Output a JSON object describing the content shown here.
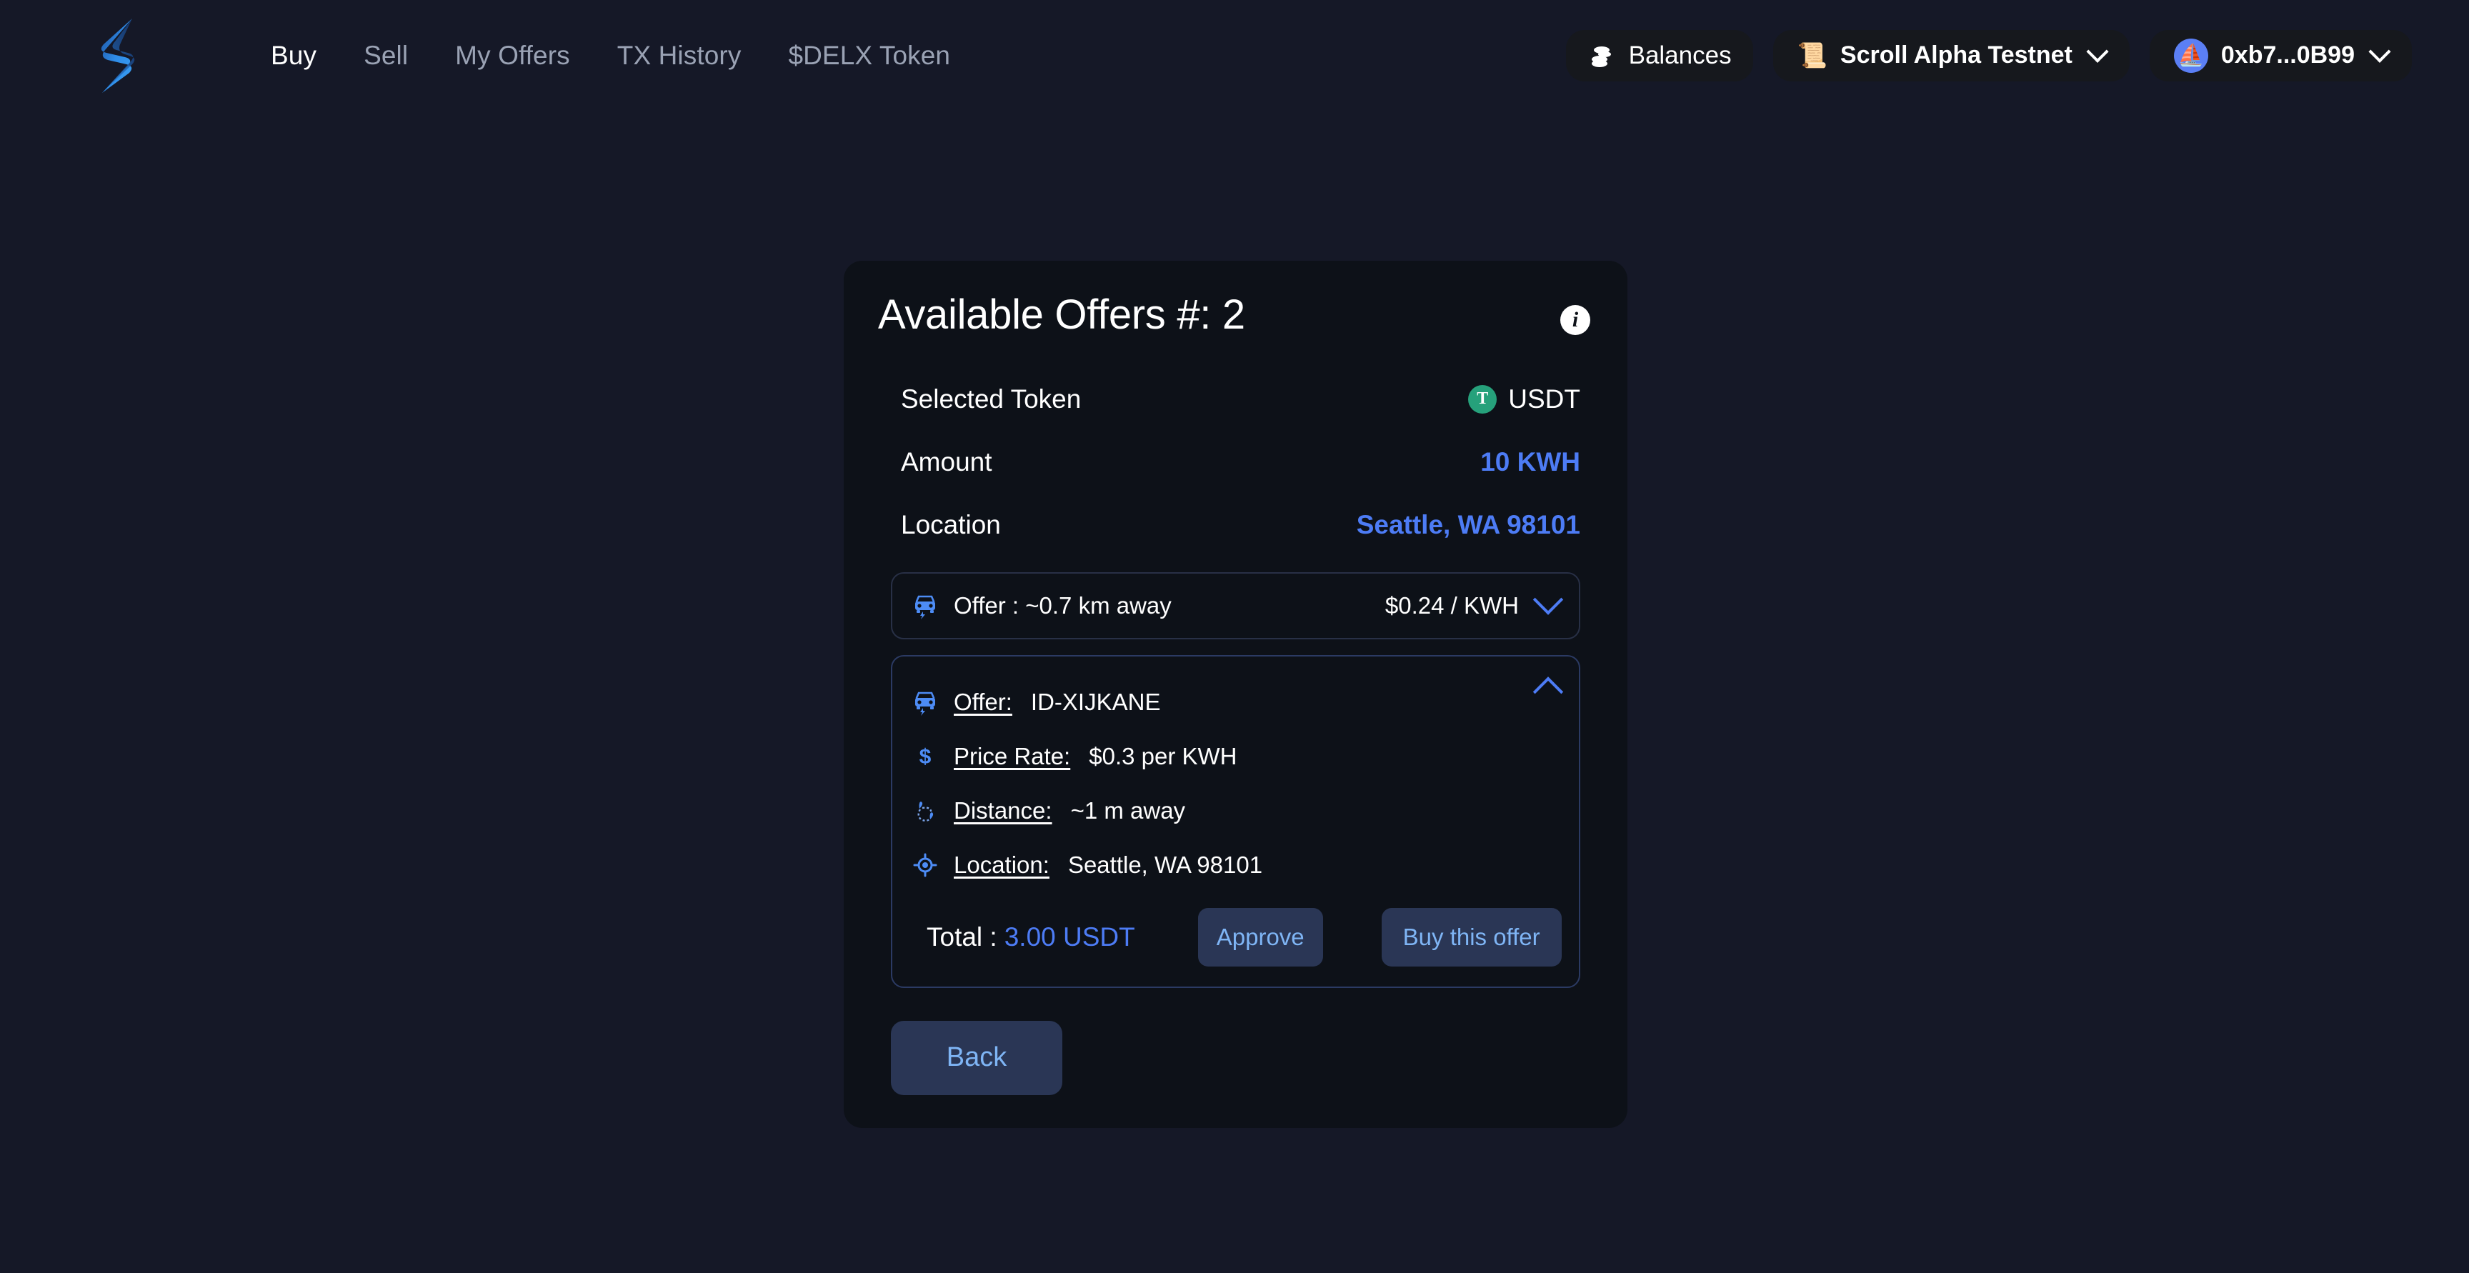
{
  "header": {
    "logo_icon": "bolt-logo-icon",
    "nav": [
      {
        "label": "Buy",
        "active": true
      },
      {
        "label": "Sell",
        "active": false
      },
      {
        "label": "My Offers",
        "active": false
      },
      {
        "label": "TX History",
        "active": false
      },
      {
        "label": "$DELX Token",
        "active": false
      }
    ],
    "balances_label": "Balances",
    "balances_icon": "coins-icon",
    "network_label": "Scroll Alpha Testnet",
    "network_icon": "scroll-icon",
    "wallet_label": "0xb7...0B99",
    "wallet_avatar_icon": "wallet-avatar-icon"
  },
  "card": {
    "title": "Available Offers #: 2",
    "info_icon": "info-icon",
    "rows": [
      {
        "label": "Selected Token",
        "value": "USDT",
        "icon": "usdt-token-icon"
      },
      {
        "label": "Amount",
        "value": "10 KWH"
      },
      {
        "label": "Location",
        "value": "Seattle, WA 98101"
      }
    ],
    "usdt_symbol": "T",
    "collapsed_offer": {
      "icon": "ev-car-icon",
      "label": "Offer : ~0.7 km away",
      "price": "$0.24 / KWH",
      "chevron_icon": "chevron-down-icon"
    },
    "expanded_offer": {
      "chevron_icon": "chevron-up-icon",
      "details": [
        {
          "icon": "ev-car-icon",
          "key": "Offer:",
          "value": "ID-XIJKANE"
        },
        {
          "icon": "dollar-icon",
          "key": "Price Rate:",
          "value": "$0.3 per KWH"
        },
        {
          "icon": "route-icon",
          "key": "Distance:",
          "value": "~1 m away"
        },
        {
          "icon": "location-target-icon",
          "key": "Location:",
          "value": "Seattle, WA 98101"
        }
      ],
      "total_label": "Total :",
      "total_value": "3.00 USDT",
      "approve_label": "Approve",
      "buy_label": "Buy this offer"
    },
    "back_label": "Back"
  },
  "colors": {
    "page_bg": "#151827",
    "card_bg": "#0d1118",
    "accent_blue": "#4d7cf5",
    "button_bg": "#2a3655",
    "button_text": "#7fb5f5",
    "usdt_green": "#26a17b",
    "nav_inactive": "#9aa2b4"
  }
}
